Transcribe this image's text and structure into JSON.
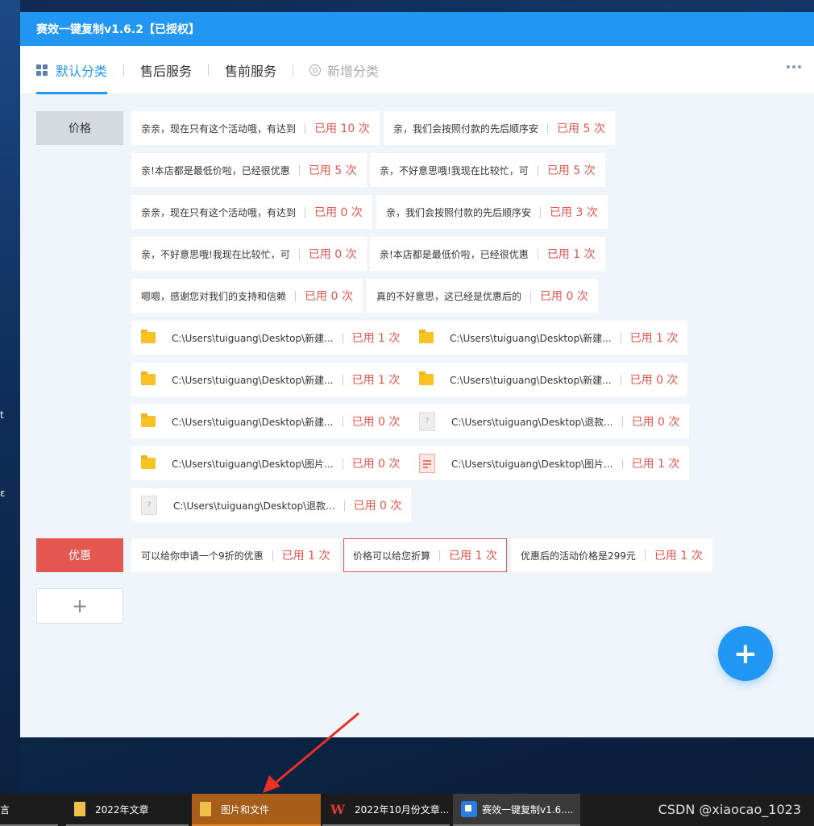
{
  "desktop": {
    "edge_fragments": [
      "t",
      "ε"
    ]
  },
  "app": {
    "title": "赛效一键复制v1.6.2【已授权】",
    "tabs": [
      {
        "label": "默认分类",
        "state": "active"
      },
      {
        "label": "售后服务",
        "state": "normal"
      },
      {
        "label": "售前服务",
        "state": "normal"
      },
      {
        "label": "新增分类",
        "state": "disabled"
      }
    ],
    "categories": [
      {
        "label": "价格"
      },
      {
        "label": "优惠"
      }
    ],
    "add_category_label": "+",
    "chips": [
      {
        "text": "亲亲，现在只有这个活动哦，有达到",
        "used": "已用 10 次"
      },
      {
        "text": "亲，我们会按照付款的先后顺序安",
        "used": "已用 5 次"
      },
      {
        "text": "亲!本店都是最低价啦，已经很优惠",
        "used": "已用 5 次"
      },
      {
        "text": "亲，不好意思哦!我现在比较忙，可",
        "used": "已用 5 次"
      },
      {
        "text": "亲亲，现在只有这个活动哦，有达到",
        "used": "已用 0 次"
      },
      {
        "text": "亲，我们会按照付款的先后顺序安",
        "used": "已用 3 次"
      },
      {
        "text": "亲，不好意思哦!我现在比较忙，可",
        "used": "已用 0 次"
      },
      {
        "text": "亲!本店都是最低价啦，已经很优惠",
        "used": "已用 1 次"
      },
      {
        "text": "嗯嗯，感谢您对我们的支持和信赖",
        "used": "已用 0 次"
      },
      {
        "text": "真的不好意思，这已经是优惠后的",
        "used": "已用 0 次"
      },
      {
        "text": "C:\\Users\\tuiguang\\Desktop\\新建...",
        "used": "已用 1 次",
        "icon": "folder-icon"
      },
      {
        "text": "C:\\Users\\tuiguang\\Desktop\\新建...",
        "used": "已用 1 次",
        "icon": "folder-icon"
      },
      {
        "text": "C:\\Users\\tuiguang\\Desktop\\新建...",
        "used": "已用 1 次",
        "icon": "folder-icon"
      },
      {
        "text": "C:\\Users\\tuiguang\\Desktop\\新建...",
        "used": "已用 0 次",
        "icon": "folder-icon"
      },
      {
        "text": "C:\\Users\\tuiguang\\Desktop\\新建...",
        "used": "已用 0 次",
        "icon": "folder-icon"
      },
      {
        "text": "C:\\Users\\tuiguang\\Desktop\\退款...",
        "used": "已用 0 次",
        "icon": "unknown-file-icon"
      },
      {
        "text": "C:\\Users\\tuiguang\\Desktop\\图片...",
        "used": "已用 0 次",
        "icon": "folder-icon"
      },
      {
        "text": "C:\\Users\\tuiguang\\Desktop\\图片...",
        "used": "已用 1 次",
        "icon": "document-icon"
      },
      {
        "text": "C:\\Users\\tuiguang\\Desktop\\退款...",
        "used": "已用 0 次",
        "icon": "unknown-file-icon"
      },
      {
        "text": "可以给你申请一个9折的优惠",
        "used": "已用 1 次"
      },
      {
        "text": "价格可以给您折算",
        "used": "已用 1 次"
      },
      {
        "text": "优惠后的活动价格是299元",
        "used": "已用 1 次"
      }
    ],
    "fab_label": "+",
    "accent": "#2196f3",
    "danger": "#e45650"
  },
  "taskbar": {
    "items": [
      {
        "label": "2022年文章",
        "icon": "folder-icon",
        "state": "normal"
      },
      {
        "label": "图片和文件",
        "icon": "folder-icon",
        "state": "active"
      },
      {
        "label": "2022年10月份文章...",
        "icon": "wps-icon",
        "state": "normal"
      },
      {
        "label": "赛效一键复制v1.6....",
        "icon": "app-icon",
        "state": "running"
      }
    ],
    "unknown_glyph": "言",
    "watermark": "CSDN @xiaocao_1023"
  }
}
